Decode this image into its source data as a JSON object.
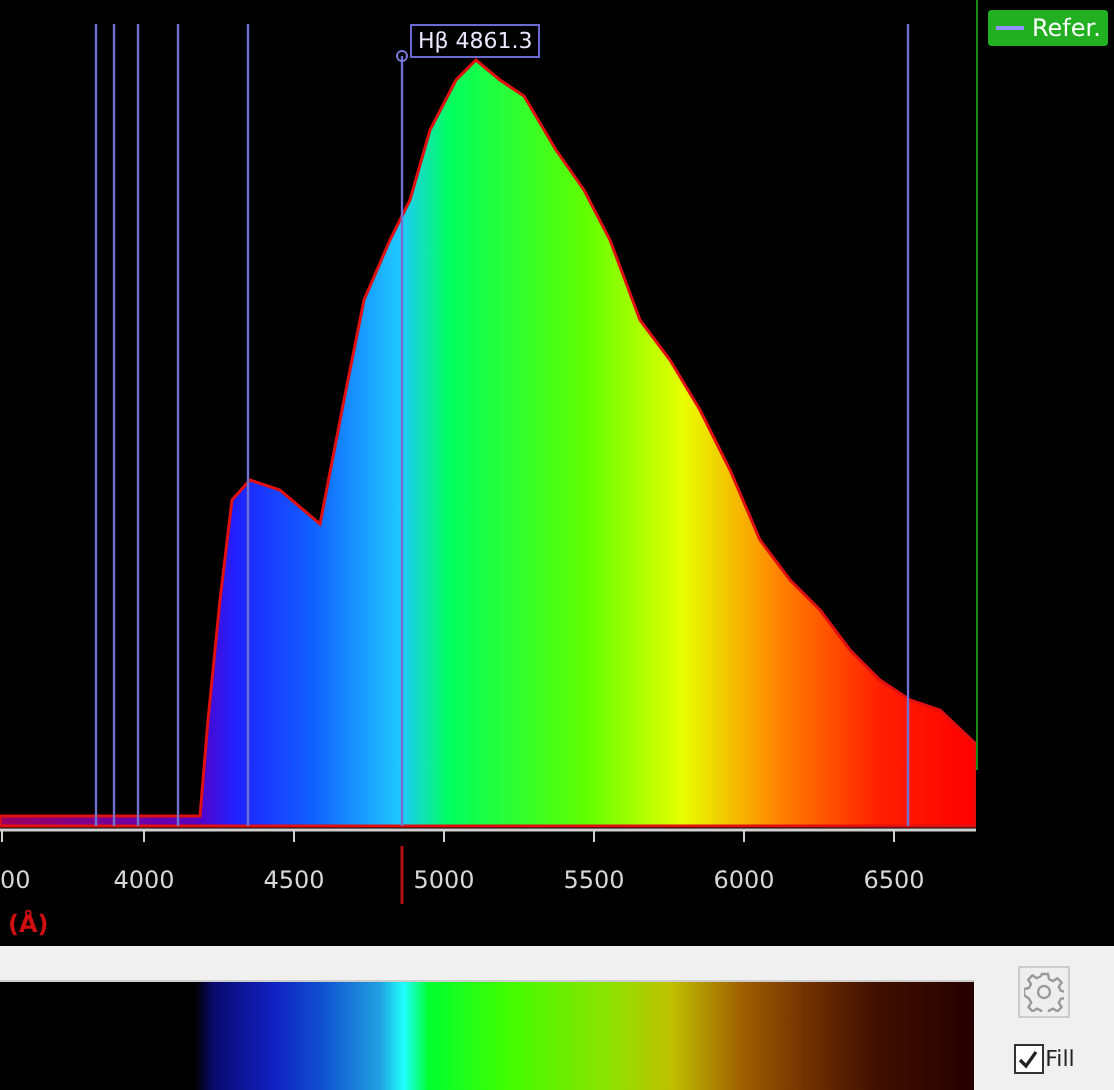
{
  "chart": {
    "marker_label": "Hβ  4861.3",
    "xticks": [
      "00",
      "4000",
      "4500",
      "5000",
      "5500",
      "6000",
      "6500"
    ],
    "xlabel": "(Å)"
  },
  "legend": {
    "label": "Refer.",
    "selected": true
  },
  "fill_checkbox": {
    "label": "Fill",
    "checked": true
  }
}
